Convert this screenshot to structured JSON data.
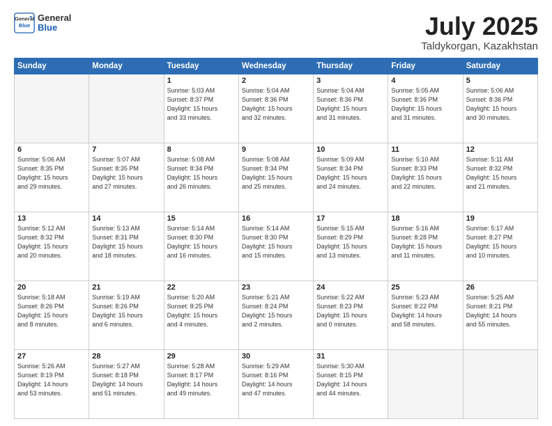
{
  "logo": {
    "general": "General",
    "blue": "Blue"
  },
  "header": {
    "month": "July 2025",
    "location": "Taldykorgan, Kazakhstan"
  },
  "weekdays": [
    "Sunday",
    "Monday",
    "Tuesday",
    "Wednesday",
    "Thursday",
    "Friday",
    "Saturday"
  ],
  "days": [
    {
      "day": "",
      "info": ""
    },
    {
      "day": "",
      "info": ""
    },
    {
      "day": "1",
      "info": "Sunrise: 5:03 AM\nSunset: 8:37 PM\nDaylight: 15 hours\nand 33 minutes."
    },
    {
      "day": "2",
      "info": "Sunrise: 5:04 AM\nSunset: 8:36 PM\nDaylight: 15 hours\nand 32 minutes."
    },
    {
      "day": "3",
      "info": "Sunrise: 5:04 AM\nSunset: 8:36 PM\nDaylight: 15 hours\nand 31 minutes."
    },
    {
      "day": "4",
      "info": "Sunrise: 5:05 AM\nSunset: 8:36 PM\nDaylight: 15 hours\nand 31 minutes."
    },
    {
      "day": "5",
      "info": "Sunrise: 5:06 AM\nSunset: 8:36 PM\nDaylight: 15 hours\nand 30 minutes."
    },
    {
      "day": "6",
      "info": "Sunrise: 5:06 AM\nSunset: 8:35 PM\nDaylight: 15 hours\nand 29 minutes."
    },
    {
      "day": "7",
      "info": "Sunrise: 5:07 AM\nSunset: 8:35 PM\nDaylight: 15 hours\nand 27 minutes."
    },
    {
      "day": "8",
      "info": "Sunrise: 5:08 AM\nSunset: 8:34 PM\nDaylight: 15 hours\nand 26 minutes."
    },
    {
      "day": "9",
      "info": "Sunrise: 5:08 AM\nSunset: 8:34 PM\nDaylight: 15 hours\nand 25 minutes."
    },
    {
      "day": "10",
      "info": "Sunrise: 5:09 AM\nSunset: 8:34 PM\nDaylight: 15 hours\nand 24 minutes."
    },
    {
      "day": "11",
      "info": "Sunrise: 5:10 AM\nSunset: 8:33 PM\nDaylight: 15 hours\nand 22 minutes."
    },
    {
      "day": "12",
      "info": "Sunrise: 5:11 AM\nSunset: 8:32 PM\nDaylight: 15 hours\nand 21 minutes."
    },
    {
      "day": "13",
      "info": "Sunrise: 5:12 AM\nSunset: 8:32 PM\nDaylight: 15 hours\nand 20 minutes."
    },
    {
      "day": "14",
      "info": "Sunrise: 5:13 AM\nSunset: 8:31 PM\nDaylight: 15 hours\nand 18 minutes."
    },
    {
      "day": "15",
      "info": "Sunrise: 5:14 AM\nSunset: 8:30 PM\nDaylight: 15 hours\nand 16 minutes."
    },
    {
      "day": "16",
      "info": "Sunrise: 5:14 AM\nSunset: 8:30 PM\nDaylight: 15 hours\nand 15 minutes."
    },
    {
      "day": "17",
      "info": "Sunrise: 5:15 AM\nSunset: 8:29 PM\nDaylight: 15 hours\nand 13 minutes."
    },
    {
      "day": "18",
      "info": "Sunrise: 5:16 AM\nSunset: 8:28 PM\nDaylight: 15 hours\nand 11 minutes."
    },
    {
      "day": "19",
      "info": "Sunrise: 5:17 AM\nSunset: 8:27 PM\nDaylight: 15 hours\nand 10 minutes."
    },
    {
      "day": "20",
      "info": "Sunrise: 5:18 AM\nSunset: 8:26 PM\nDaylight: 15 hours\nand 8 minutes."
    },
    {
      "day": "21",
      "info": "Sunrise: 5:19 AM\nSunset: 8:26 PM\nDaylight: 15 hours\nand 6 minutes."
    },
    {
      "day": "22",
      "info": "Sunrise: 5:20 AM\nSunset: 8:25 PM\nDaylight: 15 hours\nand 4 minutes."
    },
    {
      "day": "23",
      "info": "Sunrise: 5:21 AM\nSunset: 8:24 PM\nDaylight: 15 hours\nand 2 minutes."
    },
    {
      "day": "24",
      "info": "Sunrise: 5:22 AM\nSunset: 8:23 PM\nDaylight: 15 hours\nand 0 minutes."
    },
    {
      "day": "25",
      "info": "Sunrise: 5:23 AM\nSunset: 8:22 PM\nDaylight: 14 hours\nand 58 minutes."
    },
    {
      "day": "26",
      "info": "Sunrise: 5:25 AM\nSunset: 8:21 PM\nDaylight: 14 hours\nand 55 minutes."
    },
    {
      "day": "27",
      "info": "Sunrise: 5:26 AM\nSunset: 8:19 PM\nDaylight: 14 hours\nand 53 minutes."
    },
    {
      "day": "28",
      "info": "Sunrise: 5:27 AM\nSunset: 8:18 PM\nDaylight: 14 hours\nand 51 minutes."
    },
    {
      "day": "29",
      "info": "Sunrise: 5:28 AM\nSunset: 8:17 PM\nDaylight: 14 hours\nand 49 minutes."
    },
    {
      "day": "30",
      "info": "Sunrise: 5:29 AM\nSunset: 8:16 PM\nDaylight: 14 hours\nand 47 minutes."
    },
    {
      "day": "31",
      "info": "Sunrise: 5:30 AM\nSunset: 8:15 PM\nDaylight: 14 hours\nand 44 minutes."
    },
    {
      "day": "",
      "info": ""
    },
    {
      "day": "",
      "info": ""
    },
    {
      "day": "",
      "info": ""
    }
  ]
}
